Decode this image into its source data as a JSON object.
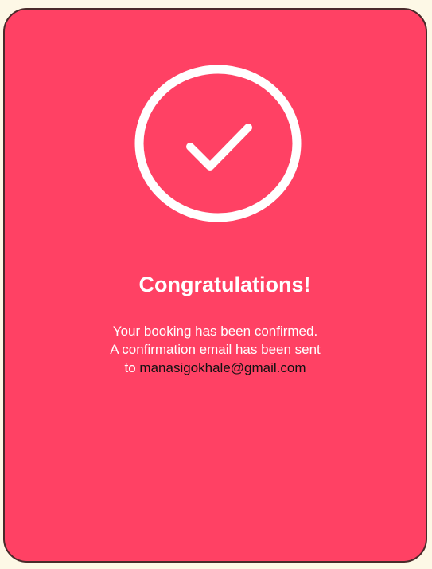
{
  "colors": {
    "background": "#fdf8e6",
    "card": "#ff4164",
    "card_border": "#4a2a2a",
    "text_light": "#ffffff",
    "email_text": "#111111"
  },
  "icon": "check-circle-icon",
  "title": "Congratulations!",
  "message": {
    "line1": "Your booking has been confirmed.",
    "line2": "A confirmation email has been sent",
    "line3_prefix": "to",
    "email": "manasigokhale@gmail.com"
  }
}
